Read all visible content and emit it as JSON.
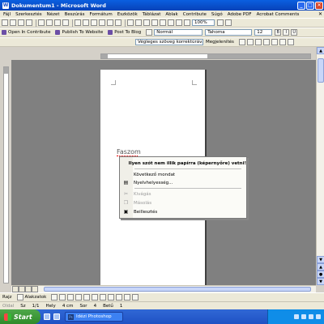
{
  "window": {
    "title": "Dokumentum1 - Microsoft Word",
    "controls": {
      "minimize": "_",
      "maximize": "□",
      "close": "✕"
    }
  },
  "menubar": {
    "items": [
      "Fájl",
      "Szerkesztés",
      "Nézet",
      "Beszúrás",
      "Formátum",
      "Eszközök",
      "Táblázat",
      "Ablak",
      "Contribute",
      "Súgó",
      "Adobe PDF",
      "Acrobat Comments"
    ],
    "close_doc": "✕"
  },
  "toolbar_links": {
    "open_in_contribute": "Open In Contribute",
    "publish_to_website": "Publish To Website",
    "post_to_blog": "Post To Blog"
  },
  "formatting": {
    "style": "Normál",
    "font": "Tahoma",
    "size": "12",
    "zoom": "100%"
  },
  "review_toolbar": {
    "markup_mode": "Végleges szöveg korrektúrával",
    "show_label": "Megjelenítés"
  },
  "document": {
    "text": "Faszom"
  },
  "context_menu": {
    "header": "Ilyen szót nem illik papírra (képernyőre) vetni!",
    "items": [
      {
        "label": "Következő mondat",
        "enabled": true,
        "icon": ""
      },
      {
        "label": "Nyelvhelyesség...",
        "enabled": true,
        "icon": "grammar-icon"
      },
      {
        "label": "Kivágás",
        "enabled": false,
        "icon": "cut-icon"
      },
      {
        "label": "Másolás",
        "enabled": false,
        "icon": "copy-icon"
      },
      {
        "label": "Beillesztés",
        "enabled": true,
        "icon": "paste-icon"
      }
    ]
  },
  "drawing_toolbar": {
    "draw_label": "Rajz",
    "autoshapes_label": "Alakzatok"
  },
  "statusbar": {
    "page": "Oldal",
    "section": "Sz",
    "page_of": "1/1",
    "position": "Hely",
    "position_value": "4 cm",
    "row": "Sor",
    "row_value": "4",
    "column": "Betű",
    "column_value": "1"
  },
  "taskbar": {
    "start_label": "Start",
    "task_label": "Idézi Photoshop"
  }
}
